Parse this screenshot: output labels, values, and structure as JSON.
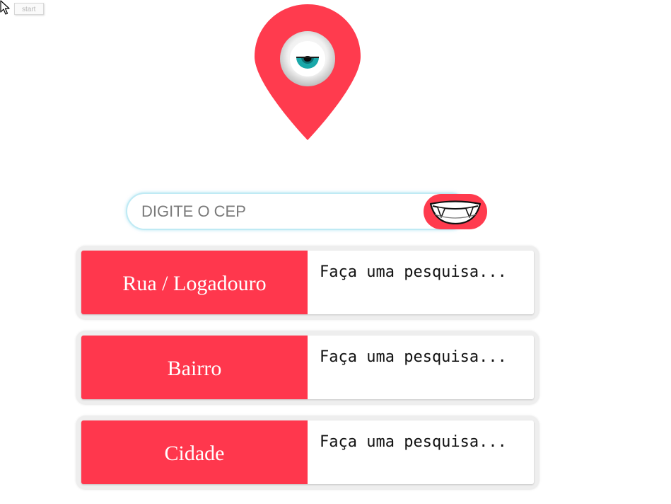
{
  "tooltip": {
    "text": "start"
  },
  "search": {
    "placeholder": "DIGITE O CEP",
    "value": ""
  },
  "results": [
    {
      "label": "Rua / Logadouro",
      "value": "Faça uma pesquisa..."
    },
    {
      "label": "Bairro",
      "value": "Faça uma pesquisa..."
    },
    {
      "label": "Cidade",
      "value": "Faça uma pesquisa..."
    }
  ],
  "icons": {
    "logo": "map-pin-eye-icon",
    "search_button": "fangs-mouth-icon",
    "cursor": "mouse-pointer-icon"
  },
  "colors": {
    "accent": "#ff3b4e",
    "label_bg": "#ff374d",
    "iris": "#19a8a9",
    "input_border": "#bfeaf4"
  }
}
